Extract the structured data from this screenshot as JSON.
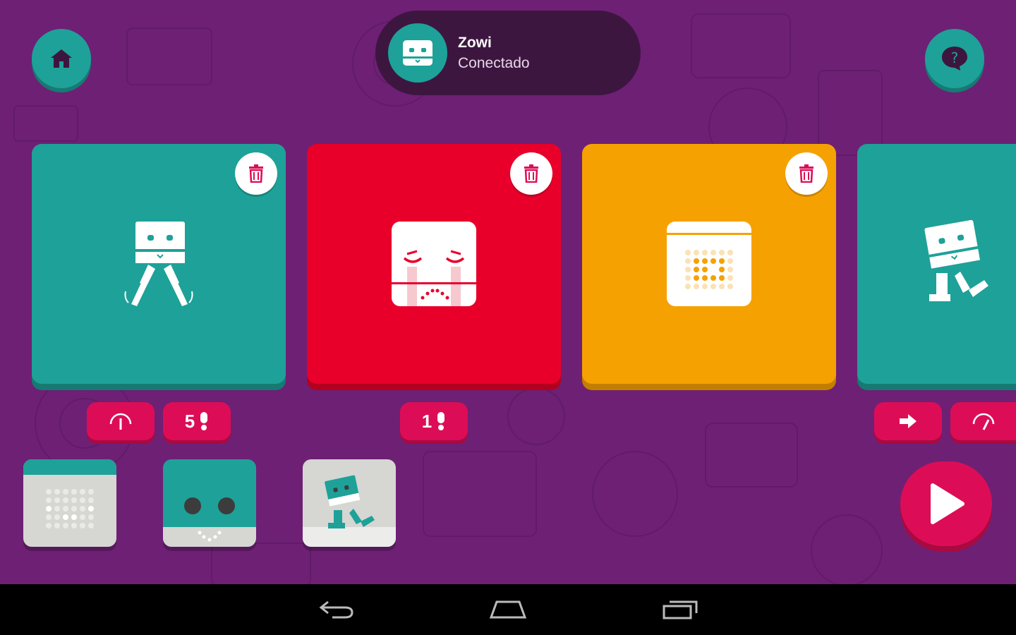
{
  "connection": {
    "robot_name": "Zowi",
    "status": "Conectado"
  },
  "icons": {
    "home": "home-icon",
    "help": "help-bubble-icon",
    "trash": "trash-icon",
    "speed": "speedometer-icon",
    "arrow": "arrow-right-icon",
    "play": "play-icon",
    "back": "back-icon",
    "nav_home": "nav-home-icon",
    "recents": "recent-apps-icon"
  },
  "colors": {
    "background": "#6e2075",
    "teal": "#1ea198",
    "red": "#e8002a",
    "orange": "#f6a102",
    "accent": "#dc0d56"
  },
  "sequence": [
    {
      "color": "teal",
      "icon": "robot-swing-legs-icon",
      "params": [
        {
          "type": "speed",
          "label": ""
        },
        {
          "type": "repeat",
          "label": "5"
        }
      ]
    },
    {
      "color": "red",
      "icon": "crying-face-icon",
      "params": [
        {
          "type": "repeat",
          "label": "1"
        }
      ]
    },
    {
      "color": "orange",
      "icon": "led-matrix-icon",
      "params": []
    },
    {
      "color": "teal",
      "icon": "robot-walk-icon",
      "params": [
        {
          "type": "direction",
          "label": ""
        },
        {
          "type": "speed",
          "label": ""
        }
      ]
    }
  ],
  "palette": [
    {
      "name": "mouth-matrix-block",
      "icon": "led-matrix-icon"
    },
    {
      "name": "face-block",
      "icon": "robot-face-icon"
    },
    {
      "name": "move-block",
      "icon": "robot-walk-icon"
    }
  ]
}
